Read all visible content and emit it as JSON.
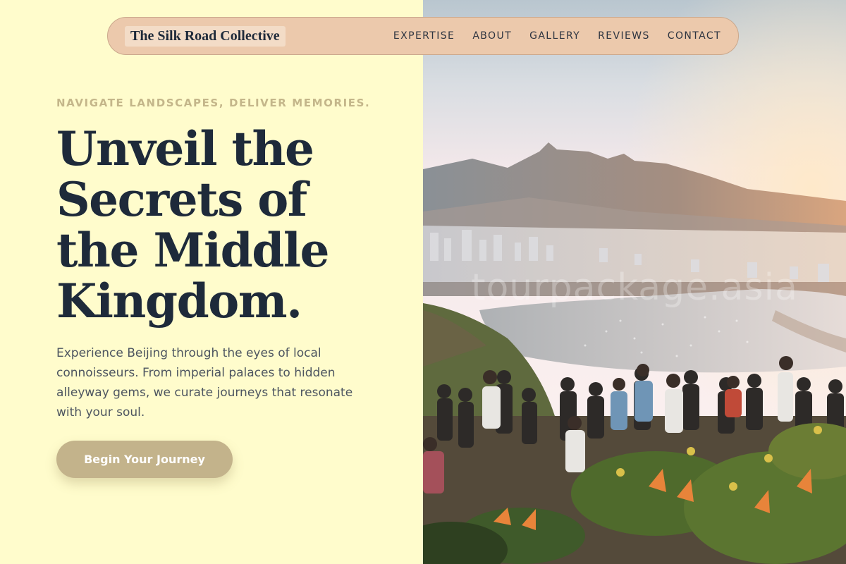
{
  "brand": {
    "name": "The Silk Road Collective"
  },
  "nav": {
    "items": [
      {
        "label": "EXPERTISE"
      },
      {
        "label": "ABOUT"
      },
      {
        "label": "GALLERY"
      },
      {
        "label": "REVIEWS"
      },
      {
        "label": "CONTACT"
      }
    ]
  },
  "hero": {
    "eyebrow": "NAVIGATE LANDSCAPES, DELIVER MEMORIES.",
    "headline_lines": [
      "Unveil the",
      "Secrets of",
      "the Middle",
      "Kingdom."
    ],
    "lede": "Experience Beijing through the eyes of local connoisseurs. From imperial palaces to hidden alleyway gems, we curate journeys that resonate with your soul.",
    "cta_label": "Begin Your Journey"
  },
  "image": {
    "watermark": "tourpackage.asia"
  },
  "colors": {
    "left_background": "#fffccc",
    "nav_background": "#ecc9ac",
    "headline": "#1e2a3a",
    "eyebrow": "#c4b68a",
    "cta_background": "#c3b38b"
  }
}
